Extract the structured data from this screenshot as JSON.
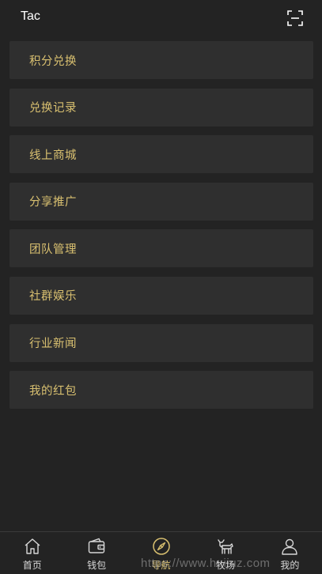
{
  "header": {
    "title": "Tac",
    "scan_icon": "scan-icon"
  },
  "menu": [
    {
      "label": "积分兑换"
    },
    {
      "label": "兑换记录"
    },
    {
      "label": "线上商城"
    },
    {
      "label": "分享推广"
    },
    {
      "label": "团队管理"
    },
    {
      "label": "社群娱乐"
    },
    {
      "label": "行业新闻"
    },
    {
      "label": "我的红包"
    }
  ],
  "tabbar": {
    "tabs": [
      {
        "label": "首页",
        "icon": "home-icon"
      },
      {
        "label": "钱包",
        "icon": "wallet-icon"
      },
      {
        "label": "导航",
        "icon": "compass-icon",
        "active": true
      },
      {
        "label": "牧场",
        "icon": "goat-icon"
      },
      {
        "label": "我的",
        "icon": "user-icon"
      }
    ]
  },
  "watermark": "https://www.huijuz.com",
  "colors": {
    "background": "#232323",
    "item_bg": "#2f2f2f",
    "accent": "#d9c070",
    "text": "#ffffff"
  }
}
